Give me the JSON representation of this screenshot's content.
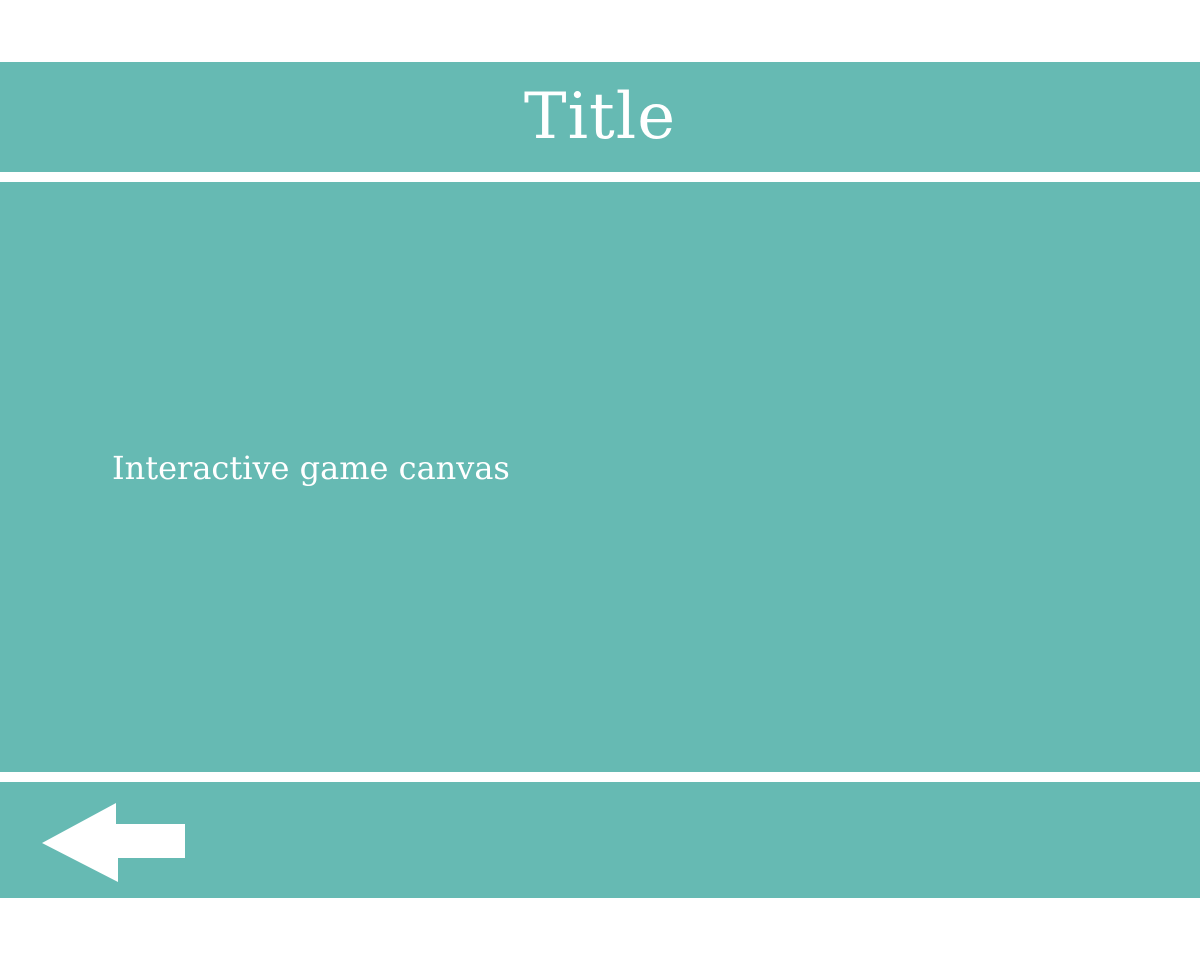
{
  "header": {
    "title": "Title"
  },
  "game": {
    "canvas_label": "Interactive game canvas"
  },
  "footer": {
    "back_icon": "back-arrow-icon"
  },
  "colors": {
    "band": "#66BAB3",
    "background": "#FFFFFF",
    "text": "#FFFFFF"
  }
}
